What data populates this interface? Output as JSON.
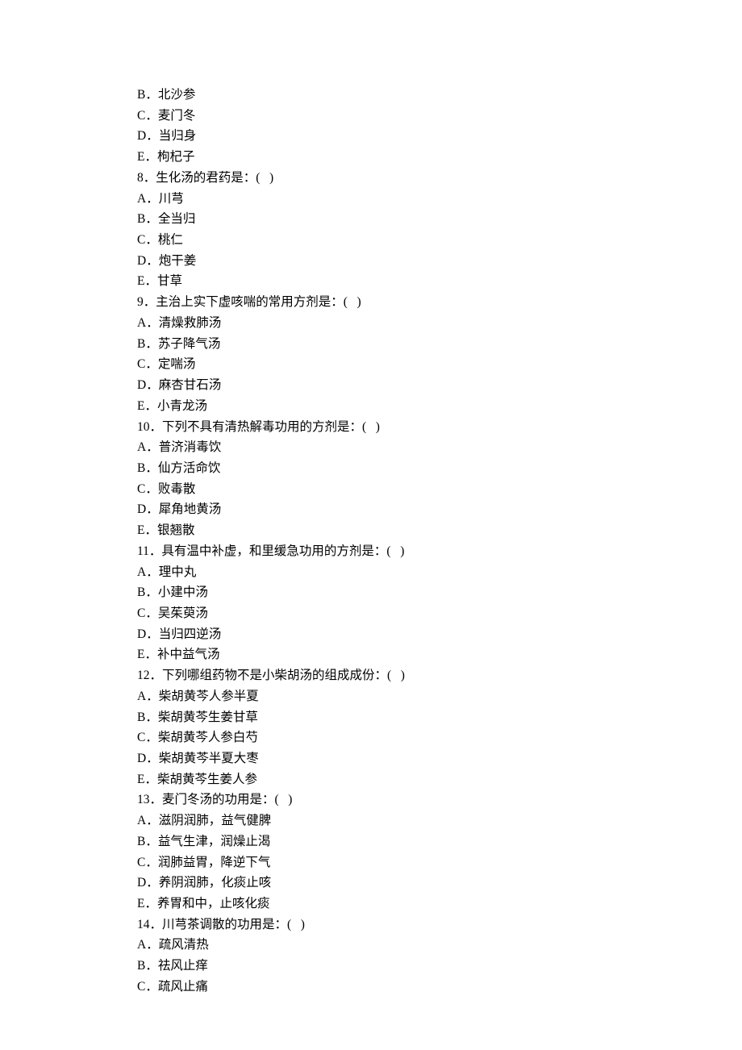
{
  "lines": [
    "B．北沙参",
    "C．麦门冬",
    "D．当归身",
    "E．枸杞子",
    "8．生化汤的君药是：(   )",
    "A．川芎",
    "B．全当归",
    "C．桃仁",
    "D．炮干姜",
    "E．甘草",
    "9．主治上实下虚咳喘的常用方剂是：(   )",
    "A．清燥救肺汤",
    "B．苏子降气汤",
    "C．定喘汤",
    "D．麻杏甘石汤",
    "E．小青龙汤",
    "10．下列不具有清热解毒功用的方剂是：(   )",
    "A．普济消毒饮",
    "B．仙方活命饮",
    "C．败毒散",
    "D．犀角地黄汤",
    "E．银翘散",
    "11．具有温中补虚，和里缓急功用的方剂是：(   )",
    "A．理中丸",
    "B．小建中汤",
    "C．吴茱萸汤",
    "D．当归四逆汤",
    "E．补中益气汤",
    "12．下列哪组药物不是小柴胡汤的组成成份：(   )",
    "A．柴胡黄芩人参半夏",
    "B．柴胡黄芩生姜甘草",
    "C．柴胡黄芩人参白芍",
    "D．柴胡黄芩半夏大枣",
    "E．柴胡黄芩生姜人参",
    "13．麦门冬汤的功用是：(   )",
    "A．滋阴润肺，益气健脾",
    "B．益气生津，润燥止渴",
    "C．润肺益胃，降逆下气",
    "D．养阴润肺，化痰止咳",
    "E．养胃和中，止咳化痰",
    "14．川芎茶调散的功用是：(   )",
    "A．疏风清热",
    "B．祛风止痒",
    "C．疏风止痛"
  ]
}
